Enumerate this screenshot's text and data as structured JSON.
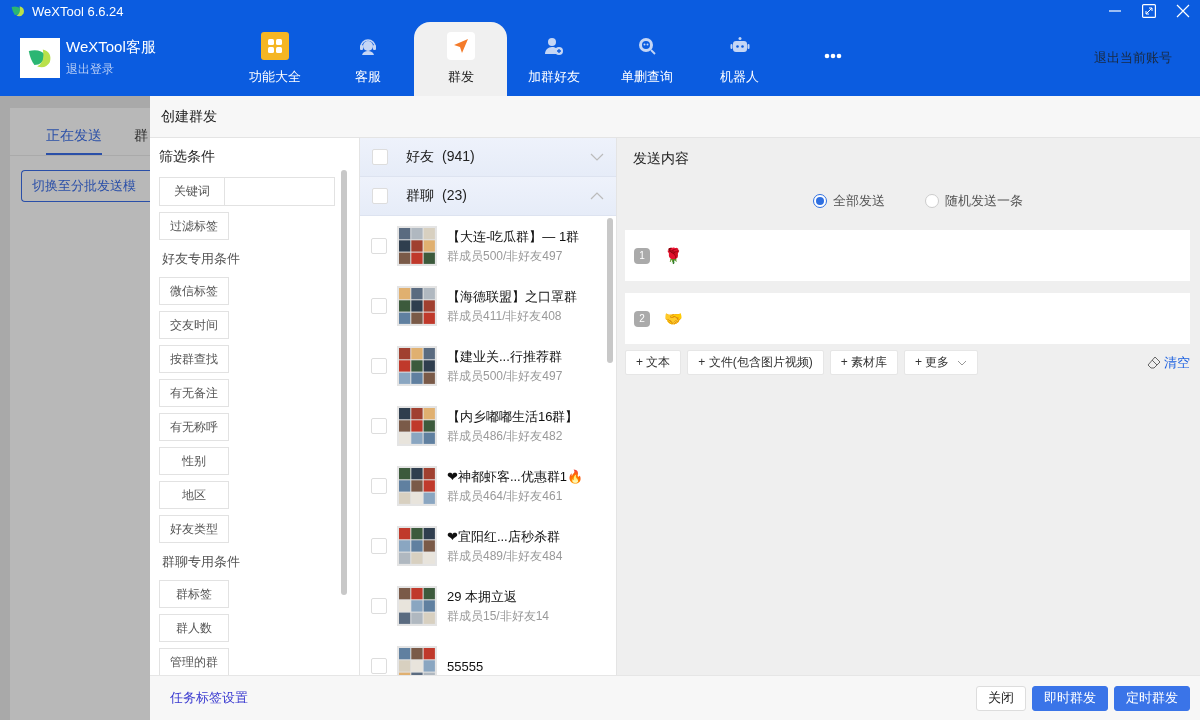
{
  "window": {
    "title": "WeXTool 6.6.24"
  },
  "account": {
    "name": "WeXTool客服",
    "logout": "退出登录"
  },
  "nav": [
    {
      "label": "功能大全",
      "kind": "grid",
      "selected": false
    },
    {
      "label": "客服",
      "kind": "service",
      "selected": false
    },
    {
      "label": "群发",
      "kind": "send",
      "selected": true
    },
    {
      "label": "加群好友",
      "kind": "add-friend",
      "selected": false
    },
    {
      "label": "单删查询",
      "kind": "check",
      "selected": false
    },
    {
      "label": "机器人",
      "kind": "robot",
      "selected": false
    },
    {
      "kind": "more",
      "selected": false
    }
  ],
  "switch_account": "退出当前账号",
  "background": {
    "tabs": [
      {
        "label": "正在发送",
        "selected": true
      },
      {
        "label": "群",
        "selected": false
      }
    ],
    "mode_button": "切换至分批发送模"
  },
  "drawer": {
    "title": "创建群发",
    "filter": {
      "heading": "筛选条件",
      "keyword_label": "关键词",
      "items": [
        {
          "kind": "button",
          "label": "过滤标签"
        },
        {
          "kind": "section",
          "label": "好友专用条件"
        },
        {
          "kind": "button",
          "label": "微信标签"
        },
        {
          "kind": "button",
          "label": "交友时间"
        },
        {
          "kind": "button",
          "label": "按群查找"
        },
        {
          "kind": "button",
          "label": "有无备注"
        },
        {
          "kind": "button",
          "label": "有无称呼"
        },
        {
          "kind": "button",
          "label": "性别"
        },
        {
          "kind": "button",
          "label": "地区"
        },
        {
          "kind": "button",
          "label": "好友类型"
        },
        {
          "kind": "section",
          "label": "群聊专用条件"
        },
        {
          "kind": "button",
          "label": "群标签"
        },
        {
          "kind": "button",
          "label": "群人数"
        },
        {
          "kind": "button",
          "label": "管理的群"
        }
      ]
    },
    "contacts": {
      "categories": [
        {
          "label": "好友",
          "count": "(941)",
          "checked": false,
          "expanded": false
        },
        {
          "label": "群聊",
          "count": "(23)",
          "checked": false,
          "expanded": true
        }
      ],
      "groups": [
        {
          "name": "【大连-吃瓜群】— 1群",
          "stats": "群成员500/非好友497",
          "checked": false
        },
        {
          "name": "【海德联盟】之口罩群",
          "stats": "群成员411/非好友408",
          "checked": false
        },
        {
          "name": "【建业关...行推荐群",
          "stats": "群成员500/非好友497",
          "checked": false
        },
        {
          "name": "【内乡嘟嘟生活16群】",
          "stats": "群成员486/非好友482",
          "checked": false
        },
        {
          "name": "❤神都虾客...优惠群1🔥",
          "stats": "群成员464/非好友461",
          "checked": false
        },
        {
          "name": "❤宜阳红...店秒杀群",
          "stats": "群成员489/非好友484",
          "checked": false
        },
        {
          "name": "29 本拥立返",
          "stats": "群成员15/非好友14",
          "checked": false
        },
        {
          "name": "55555",
          "checked": false
        }
      ]
    },
    "content": {
      "heading": "发送内容",
      "modes": [
        {
          "label": "全部发送",
          "selected": true
        },
        {
          "label": "随机发送一条",
          "selected": false
        }
      ],
      "messages": [
        {
          "index": "1",
          "text": "🌹"
        },
        {
          "index": "2",
          "text": "🤝"
        }
      ],
      "actions": [
        {
          "label": "+ 文本",
          "kind": "plain"
        },
        {
          "label": "+ 文件(包含图片视频)",
          "kind": "plain"
        },
        {
          "label": "+ 素材库",
          "kind": "plain"
        },
        {
          "label": "+ 更多",
          "kind": "dropdown"
        }
      ],
      "clear": "清空"
    },
    "footer": {
      "link": "任务标签设置",
      "buttons": [
        {
          "label": "关闭",
          "kind": "plain"
        },
        {
          "label": "即时群发",
          "kind": "primary"
        },
        {
          "label": "定时群发",
          "kind": "primary"
        }
      ]
    }
  }
}
